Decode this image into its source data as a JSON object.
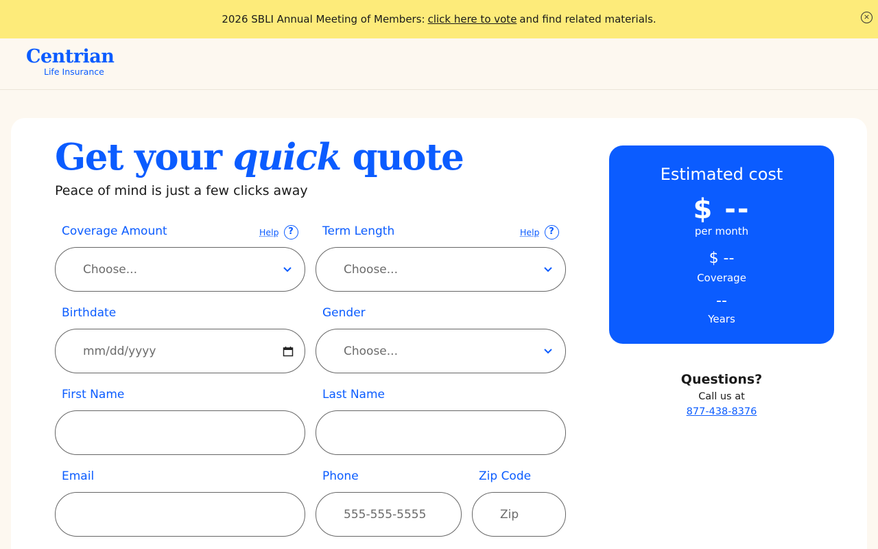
{
  "banner": {
    "text_before": "2026 SBLI Annual Meeting of Members:",
    "link_text": "click here to vote",
    "text_after": "and find related materials.",
    "close_symbol": "×"
  },
  "header": {
    "brand": "Centrian",
    "brand_sub": "Life Insurance"
  },
  "form": {
    "title_part1": "Get your",
    "title_part2": "quick",
    "title_part3": "quote",
    "subtitle": "Peace of mind is just a few clicks away",
    "help_label": "Help",
    "help_symbol": "?",
    "coverage": {
      "label": "Coverage Amount",
      "value": "Choose..."
    },
    "term": {
      "label": "Term Length",
      "value": "Choose..."
    },
    "birthdate": {
      "label": "Birthdate",
      "placeholder": "mm/dd/yyyy"
    },
    "gender": {
      "label": "Gender",
      "value": "Choose..."
    },
    "first_name": {
      "label": "First Name",
      "placeholder": ""
    },
    "last_name": {
      "label": "Last Name",
      "placeholder": ""
    },
    "email": {
      "label": "Email",
      "placeholder": ""
    },
    "phone": {
      "label": "Phone",
      "placeholder": "555-555-5555"
    },
    "zip": {
      "label": "Zip Code",
      "placeholder": "Zip"
    }
  },
  "estimate": {
    "heading": "Estimated cost",
    "monthly": "$ --",
    "monthly_label": "per month",
    "coverage": "$ --",
    "coverage_label": "Coverage",
    "years": "--",
    "years_label": "Years"
  },
  "questions": {
    "heading": "Questions?",
    "call": "Call us at",
    "phone": "877-438-8376"
  },
  "colors": {
    "brand_blue": "#0b5cff",
    "banner_yellow": "#fdeb7a"
  }
}
